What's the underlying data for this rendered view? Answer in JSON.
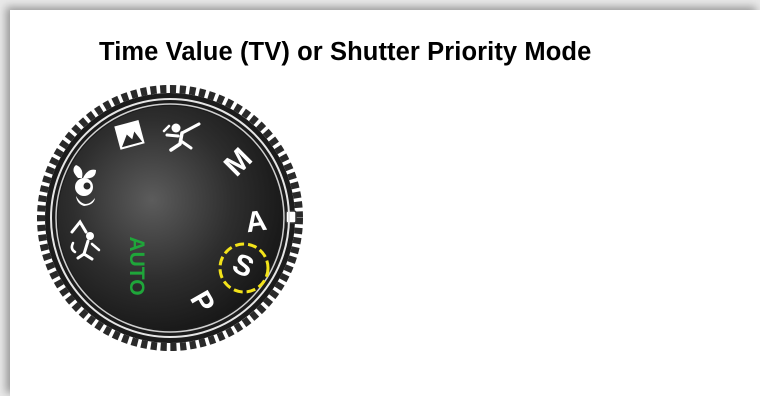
{
  "slide": {
    "title": "Time Value (TV) or Shutter Priority Mode"
  },
  "dial": {
    "modes": [
      {
        "id": "manual",
        "label": "M"
      },
      {
        "id": "aperture-priority",
        "label": "A"
      },
      {
        "id": "shutter-priority",
        "label": "S",
        "highlighted": true
      },
      {
        "id": "program",
        "label": "P"
      },
      {
        "id": "auto",
        "label": "AUTO",
        "color": "#1fa63a"
      }
    ],
    "icons": [
      "sports-icon",
      "landscape-icon",
      "portrait-icon",
      "macro-icon",
      "night-portrait-icon"
    ],
    "highlight_color": "#f3e31a"
  }
}
